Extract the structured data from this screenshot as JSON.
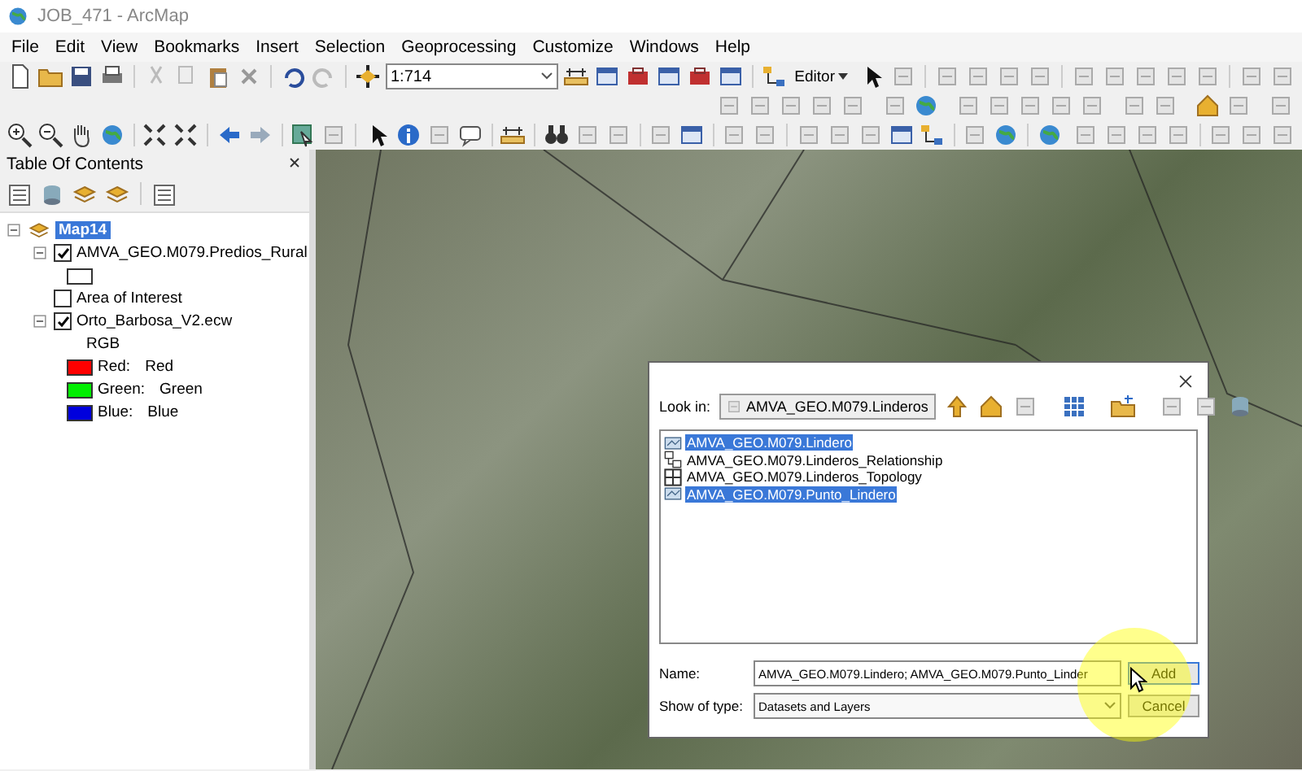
{
  "window": {
    "title": "JOB_471 - ArcMap"
  },
  "menu": [
    "File",
    "Edit",
    "View",
    "Bookmarks",
    "Insert",
    "Selection",
    "Geoprocessing",
    "Customize",
    "Windows",
    "Help"
  ],
  "toolbar": {
    "scale": "1:714",
    "editor_menu": "Editor"
  },
  "table_of_contents": {
    "title": "Table Of Contents",
    "tree": [
      {
        "label": "Map14",
        "selected": true,
        "expanded": true,
        "children": [
          {
            "label": "AMVA_GEO.M079.Predios_Rural",
            "checked": true,
            "expanded": true,
            "legend": [
              {
                "kind": "outline"
              }
            ]
          },
          {
            "label": "Area of Interest",
            "checked": false
          },
          {
            "label": "Orto_Barbosa_V2.ecw",
            "checked": true,
            "expanded": true,
            "legend": [
              {
                "kind": "heading",
                "label": "RGB"
              },
              {
                "kind": "band",
                "label": "Red:",
                "value": "Red",
                "color": "#ff0000"
              },
              {
                "kind": "band",
                "label": "Green:",
                "value": "Green",
                "color": "#00ee00"
              },
              {
                "kind": "band",
                "label": "Blue:",
                "value": "Blue",
                "color": "#0000dd"
              }
            ]
          }
        ]
      }
    ]
  },
  "dialog": {
    "look_in_label": "Look in:",
    "look_in": "AMVA_GEO.M079.Linderos",
    "items": [
      {
        "kind": "feature-class",
        "label": "AMVA_GEO.M079.Lindero",
        "selected": true
      },
      {
        "kind": "relationship",
        "label": "AMVA_GEO.M079.Linderos_Relationship",
        "selected": false
      },
      {
        "kind": "topology",
        "label": "AMVA_GEO.M079.Linderos_Topology",
        "selected": false
      },
      {
        "kind": "feature-class",
        "label": "AMVA_GEO.M079.Punto_Lindero",
        "selected": true
      }
    ],
    "name_label": "Name:",
    "name": "AMVA_GEO.M079.Lindero; AMVA_GEO.M079.Punto_Linder",
    "type_label": "Show of type:",
    "type": "Datasets and Layers",
    "buttons": [
      "Add",
      "Cancel"
    ]
  }
}
